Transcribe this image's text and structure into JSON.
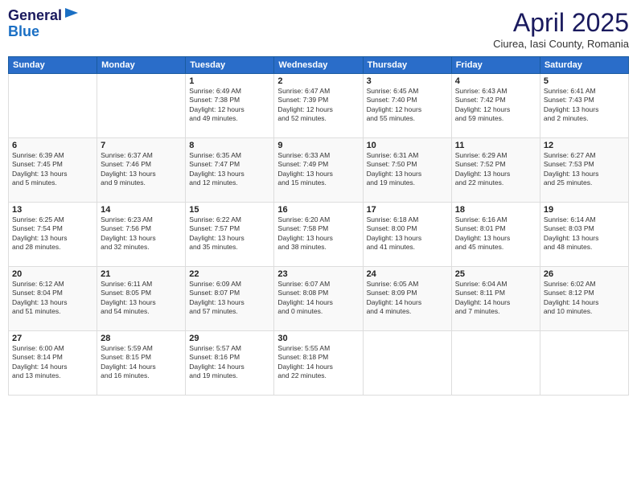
{
  "header": {
    "logo_general": "General",
    "logo_blue": "Blue",
    "month_title": "April 2025",
    "subtitle": "Ciurea, Iasi County, Romania"
  },
  "days_of_week": [
    "Sunday",
    "Monday",
    "Tuesday",
    "Wednesday",
    "Thursday",
    "Friday",
    "Saturday"
  ],
  "weeks": [
    [
      {
        "day": "",
        "info": ""
      },
      {
        "day": "",
        "info": ""
      },
      {
        "day": "1",
        "info": "Sunrise: 6:49 AM\nSunset: 7:38 PM\nDaylight: 12 hours\nand 49 minutes."
      },
      {
        "day": "2",
        "info": "Sunrise: 6:47 AM\nSunset: 7:39 PM\nDaylight: 12 hours\nand 52 minutes."
      },
      {
        "day": "3",
        "info": "Sunrise: 6:45 AM\nSunset: 7:40 PM\nDaylight: 12 hours\nand 55 minutes."
      },
      {
        "day": "4",
        "info": "Sunrise: 6:43 AM\nSunset: 7:42 PM\nDaylight: 12 hours\nand 59 minutes."
      },
      {
        "day": "5",
        "info": "Sunrise: 6:41 AM\nSunset: 7:43 PM\nDaylight: 13 hours\nand 2 minutes."
      }
    ],
    [
      {
        "day": "6",
        "info": "Sunrise: 6:39 AM\nSunset: 7:45 PM\nDaylight: 13 hours\nand 5 minutes."
      },
      {
        "day": "7",
        "info": "Sunrise: 6:37 AM\nSunset: 7:46 PM\nDaylight: 13 hours\nand 9 minutes."
      },
      {
        "day": "8",
        "info": "Sunrise: 6:35 AM\nSunset: 7:47 PM\nDaylight: 13 hours\nand 12 minutes."
      },
      {
        "day": "9",
        "info": "Sunrise: 6:33 AM\nSunset: 7:49 PM\nDaylight: 13 hours\nand 15 minutes."
      },
      {
        "day": "10",
        "info": "Sunrise: 6:31 AM\nSunset: 7:50 PM\nDaylight: 13 hours\nand 19 minutes."
      },
      {
        "day": "11",
        "info": "Sunrise: 6:29 AM\nSunset: 7:52 PM\nDaylight: 13 hours\nand 22 minutes."
      },
      {
        "day": "12",
        "info": "Sunrise: 6:27 AM\nSunset: 7:53 PM\nDaylight: 13 hours\nand 25 minutes."
      }
    ],
    [
      {
        "day": "13",
        "info": "Sunrise: 6:25 AM\nSunset: 7:54 PM\nDaylight: 13 hours\nand 28 minutes."
      },
      {
        "day": "14",
        "info": "Sunrise: 6:23 AM\nSunset: 7:56 PM\nDaylight: 13 hours\nand 32 minutes."
      },
      {
        "day": "15",
        "info": "Sunrise: 6:22 AM\nSunset: 7:57 PM\nDaylight: 13 hours\nand 35 minutes."
      },
      {
        "day": "16",
        "info": "Sunrise: 6:20 AM\nSunset: 7:58 PM\nDaylight: 13 hours\nand 38 minutes."
      },
      {
        "day": "17",
        "info": "Sunrise: 6:18 AM\nSunset: 8:00 PM\nDaylight: 13 hours\nand 41 minutes."
      },
      {
        "day": "18",
        "info": "Sunrise: 6:16 AM\nSunset: 8:01 PM\nDaylight: 13 hours\nand 45 minutes."
      },
      {
        "day": "19",
        "info": "Sunrise: 6:14 AM\nSunset: 8:03 PM\nDaylight: 13 hours\nand 48 minutes."
      }
    ],
    [
      {
        "day": "20",
        "info": "Sunrise: 6:12 AM\nSunset: 8:04 PM\nDaylight: 13 hours\nand 51 minutes."
      },
      {
        "day": "21",
        "info": "Sunrise: 6:11 AM\nSunset: 8:05 PM\nDaylight: 13 hours\nand 54 minutes."
      },
      {
        "day": "22",
        "info": "Sunrise: 6:09 AM\nSunset: 8:07 PM\nDaylight: 13 hours\nand 57 minutes."
      },
      {
        "day": "23",
        "info": "Sunrise: 6:07 AM\nSunset: 8:08 PM\nDaylight: 14 hours\nand 0 minutes."
      },
      {
        "day": "24",
        "info": "Sunrise: 6:05 AM\nSunset: 8:09 PM\nDaylight: 14 hours\nand 4 minutes."
      },
      {
        "day": "25",
        "info": "Sunrise: 6:04 AM\nSunset: 8:11 PM\nDaylight: 14 hours\nand 7 minutes."
      },
      {
        "day": "26",
        "info": "Sunrise: 6:02 AM\nSunset: 8:12 PM\nDaylight: 14 hours\nand 10 minutes."
      }
    ],
    [
      {
        "day": "27",
        "info": "Sunrise: 6:00 AM\nSunset: 8:14 PM\nDaylight: 14 hours\nand 13 minutes."
      },
      {
        "day": "28",
        "info": "Sunrise: 5:59 AM\nSunset: 8:15 PM\nDaylight: 14 hours\nand 16 minutes."
      },
      {
        "day": "29",
        "info": "Sunrise: 5:57 AM\nSunset: 8:16 PM\nDaylight: 14 hours\nand 19 minutes."
      },
      {
        "day": "30",
        "info": "Sunrise: 5:55 AM\nSunset: 8:18 PM\nDaylight: 14 hours\nand 22 minutes."
      },
      {
        "day": "",
        "info": ""
      },
      {
        "day": "",
        "info": ""
      },
      {
        "day": "",
        "info": ""
      }
    ]
  ]
}
